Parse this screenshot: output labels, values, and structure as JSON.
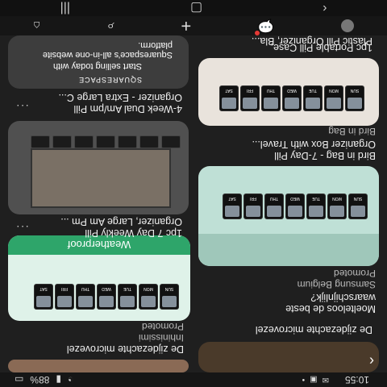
{
  "status": {
    "time": "10:55",
    "battery": "88%"
  },
  "cards": [
    {
      "caption_1": "De zijdezachte microvezel",
      "caption_2": "",
      "sub": ""
    },
    {
      "caption_1": "Moelteloos de beste",
      "caption_2": "waarschijnlijk?",
      "sub": "Samsung Belgium",
      "sub2": "Promoted"
    },
    {
      "caption_1": "Weatherproof",
      "sub": ""
    },
    {
      "caption_1": "1pc 7 Day Weekly Pill",
      "caption_2": "Organizer, Large Am Pm ..."
    },
    {
      "caption_1": "Bird in Bag - 7-Day Pill",
      "caption_2": "Organizer Box with Travel...",
      "sub": "Bird in Bag"
    },
    {
      "caption_1": "4-Week Dual Am/pm Pill",
      "caption_2": "Organizer - Extra Large C..."
    },
    {
      "caption_1": "1pc Portable Pill Case,",
      "caption_2": "Plastic Pill Organizer, Bla..."
    },
    {
      "caption_1": "SQUARESPACE",
      "caption_2": "Start selling today with",
      "caption_3": "Squarespace's all-in-one website platform."
    }
  ],
  "pill_days": [
    "SUN",
    "MON",
    "TUE",
    "WED",
    "THU",
    "FRI",
    "SAT"
  ],
  "tabs": [
    "home-icon",
    "search-icon",
    "add-icon",
    "messages-icon",
    "profile-icon"
  ],
  "nav": [
    "back-icon",
    "home-button-icon",
    "recents-icon"
  ],
  "colors": {
    "bg": "#1f1f1f",
    "accent": "#e53935",
    "mint": "#cfe9dc"
  }
}
